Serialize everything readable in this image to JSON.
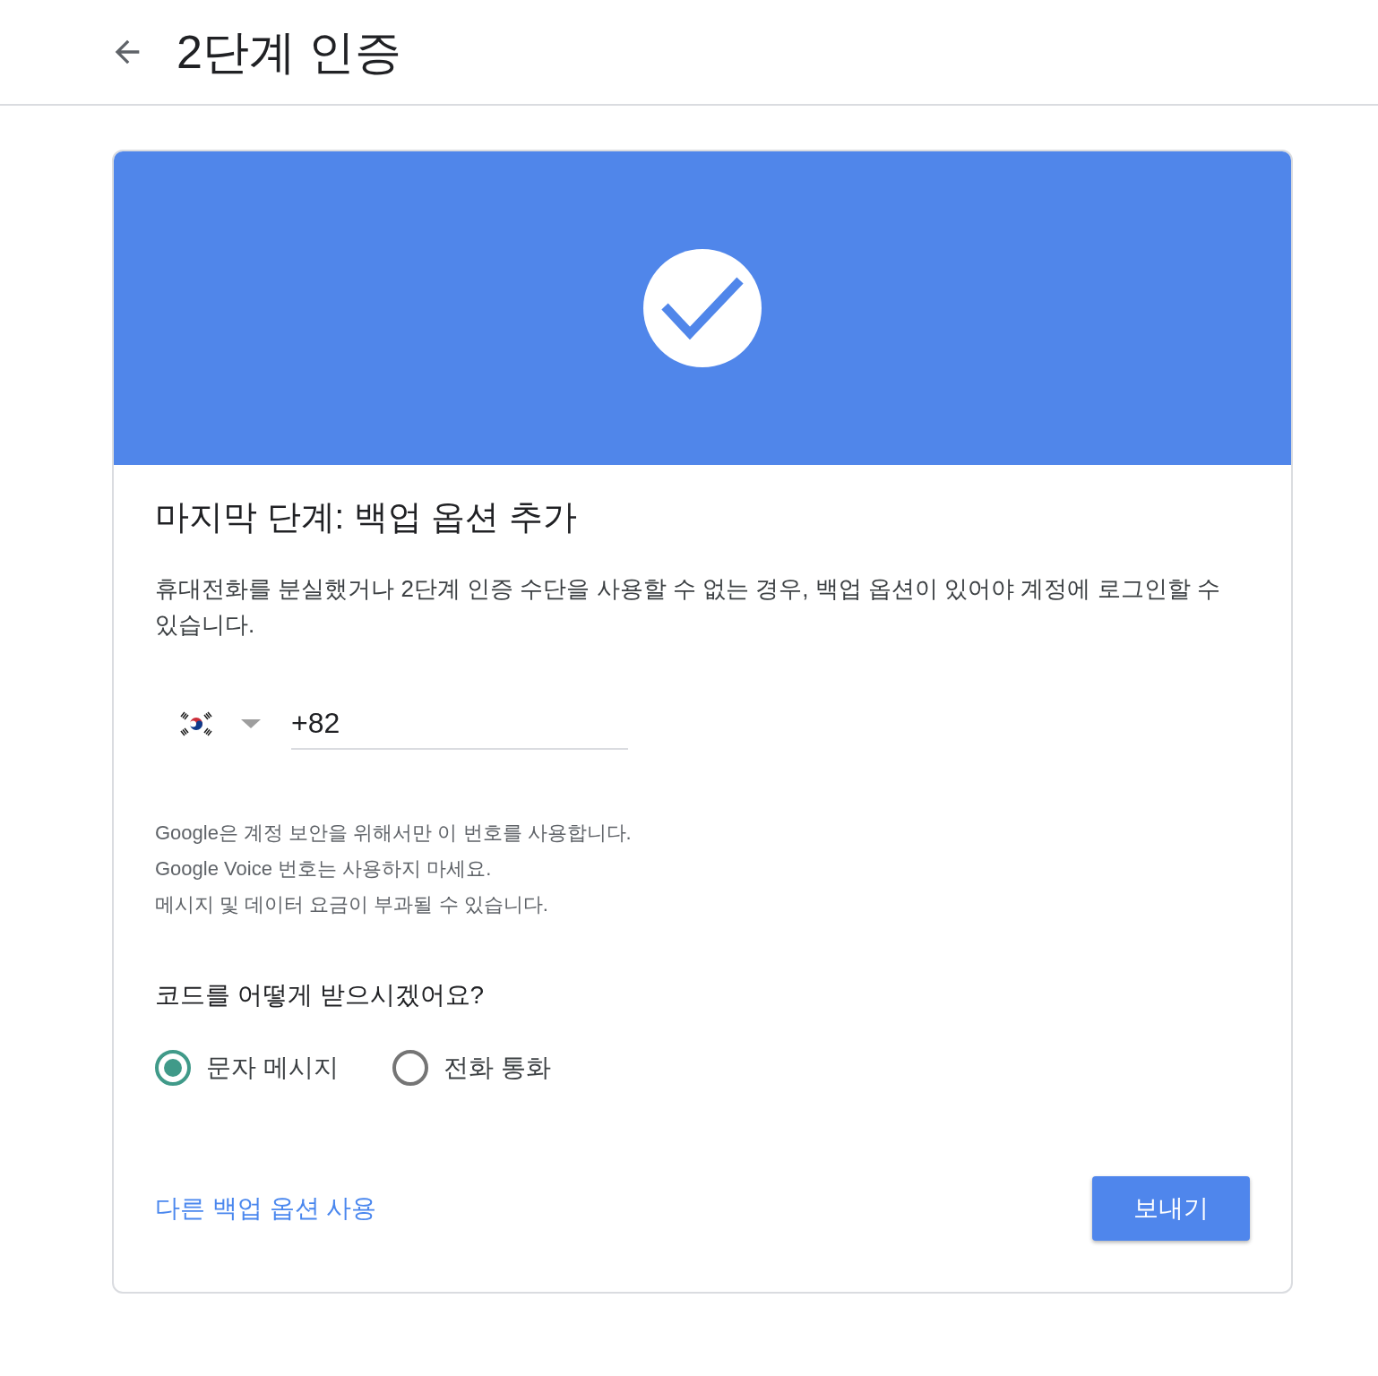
{
  "header": {
    "title": "2단계 인증"
  },
  "card": {
    "heading": "마지막 단계: 백업 옵션 추가",
    "description": "휴대전화를 분실했거나 2단계 인증 수단을 사용할 수 없는 경우, 백업 옵션이 있어야 계정에 로그인할 수 있습니다.",
    "phone": {
      "value": "+82"
    },
    "notes": [
      "Google은 계정 보안을 위해서만 이 번호를 사용합니다.",
      "Google Voice 번호는 사용하지 마세요.",
      "메시지 및 데이터 요금이 부과될 수 있습니다."
    ],
    "question": "코드를 어떻게 받으시겠어요?",
    "options": [
      {
        "label": "문자 메시지",
        "selected": true
      },
      {
        "label": "전화 통화",
        "selected": false
      }
    ],
    "link": "다른 백업 옵션 사용",
    "submit_button": "보내기"
  }
}
